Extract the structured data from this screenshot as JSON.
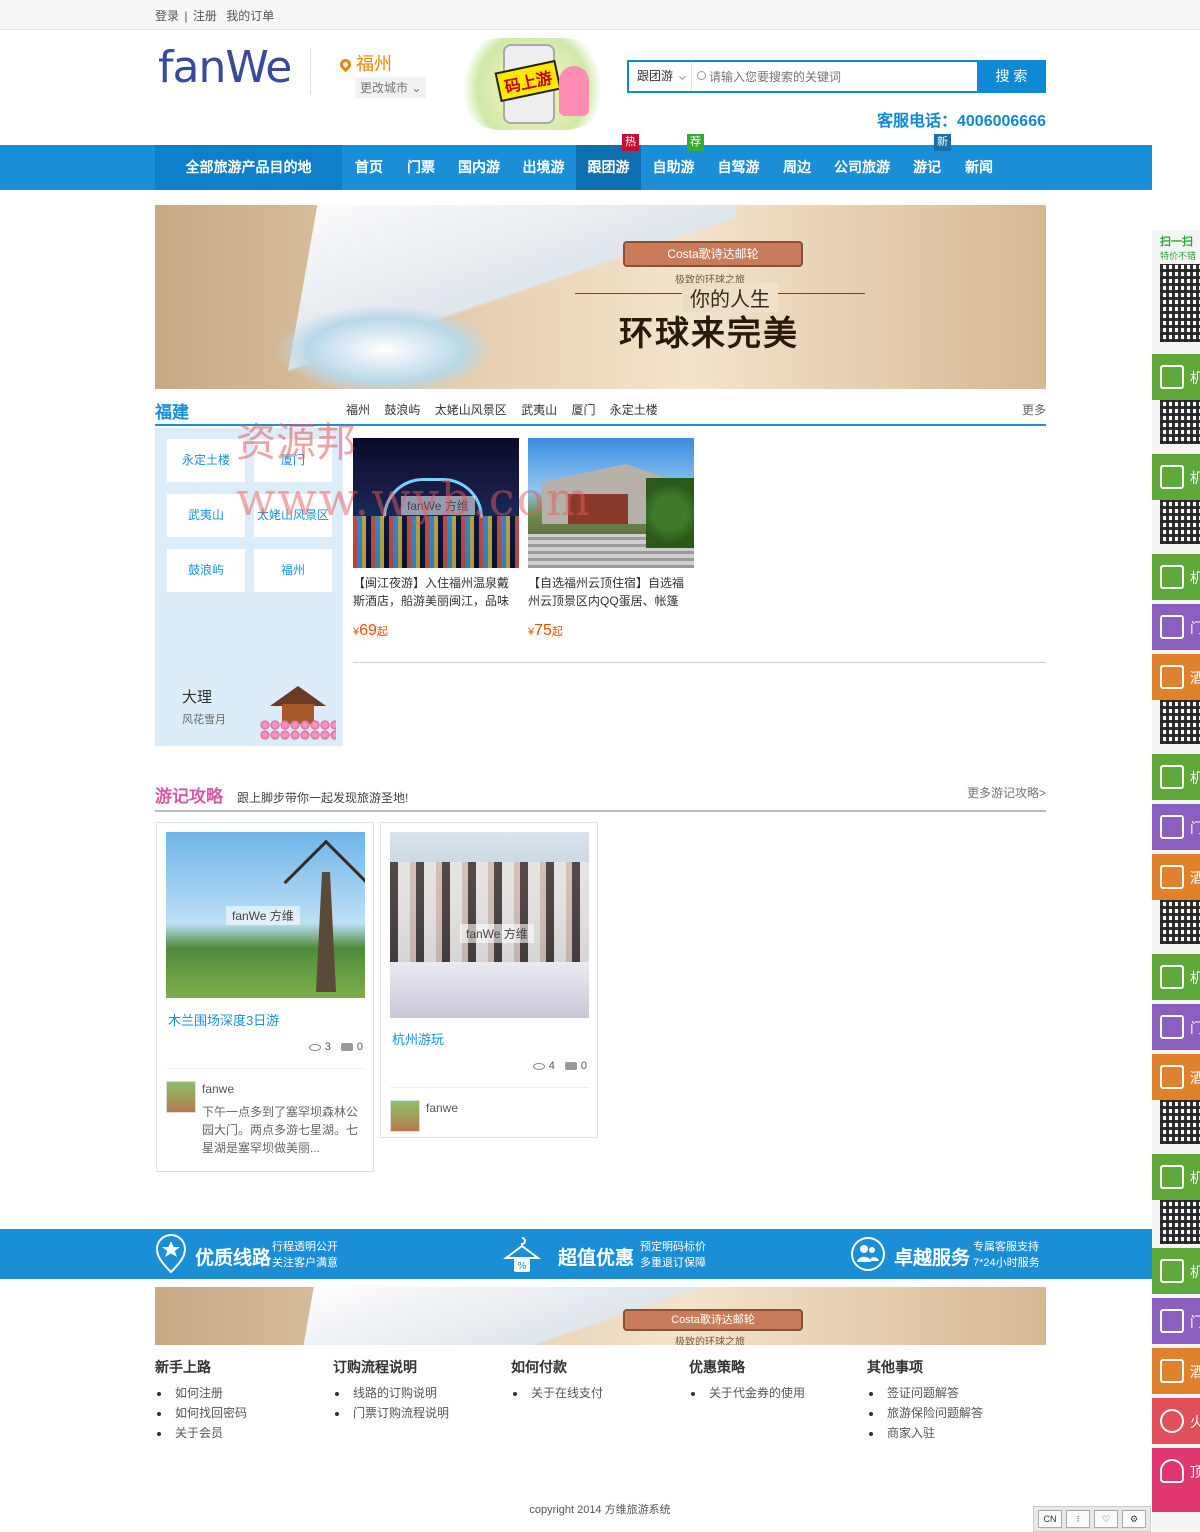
{
  "topbar": {
    "login": "登录",
    "sep": "|",
    "register": "注册",
    "orders": "我的订单"
  },
  "header": {
    "logo_main": "fanWe",
    "city": "福州",
    "change_city": "更改城市",
    "promo_text": "码上游",
    "search_scope": "跟团游",
    "search_placeholder": "请输入您要搜索的关键词",
    "search_button": "搜 索",
    "hotline": "客服电话：4006006666"
  },
  "nav": {
    "all_label": "全部旅游产品目的地",
    "items": [
      {
        "label": "首页",
        "badge": ""
      },
      {
        "label": "门票",
        "badge": ""
      },
      {
        "label": "国内游",
        "badge": ""
      },
      {
        "label": "出境游",
        "badge": ""
      },
      {
        "label": "跟团游",
        "badge": "热"
      },
      {
        "label": "自助游",
        "badge": "荐"
      },
      {
        "label": "自驾游",
        "badge": ""
      },
      {
        "label": "周边",
        "badge": ""
      },
      {
        "label": "公司旅游",
        "badge": ""
      },
      {
        "label": "游记",
        "badge": "新"
      },
      {
        "label": "新闻",
        "badge": ""
      }
    ],
    "badge_colors": {
      "热": "#c8102e",
      "荐": "#3aa635",
      "新": "#1a6fa8"
    }
  },
  "banner": {
    "brand": "Costa歌诗达邮轮",
    "tagline": "极致的环球之旅",
    "line1": "你的人生",
    "line2": "环球来完美"
  },
  "fujian": {
    "title": "福建",
    "tabs": [
      "福州",
      "鼓浪屿",
      "太姥山风景区",
      "武夷山",
      "厦门",
      "永定土楼"
    ],
    "more": "更多",
    "tags": [
      "永定土楼",
      "厦门",
      "武夷山",
      "太姥山风景区",
      "鼓浪屿",
      "福州"
    ],
    "promo_name": "大理",
    "promo_desc": "风花雪月",
    "products": [
      {
        "name": "【闽江夜游】入住福州温泉戴斯酒店，船游美丽闽江，品味夜...",
        "currency": "¥",
        "price": "69",
        "suffix": "起",
        "watermark": "fanWe 方维"
      },
      {
        "name": "【自选福州云顶住宿】自选福州云顶景区内QQ蛋居、帐篷房...",
        "currency": "¥",
        "price": "75",
        "suffix": "起",
        "watermark": ""
      }
    ]
  },
  "notes": {
    "title": "游记攻略",
    "subtitle": "跟上脚步带你一起发现旅游圣地!",
    "more": "更多游记攻略>",
    "cards": [
      {
        "title": "木兰围场深度3日游",
        "views": "3",
        "comments": "0",
        "user": "fanwe",
        "desc": "下午一点多到了塞罕坝森林公园大门。两点多游七星湖。七星湖是塞罕坝做美丽...",
        "watermark": "fanWe 方维"
      },
      {
        "title": "杭州游玩",
        "views": "4",
        "comments": "0",
        "user": "fanwe",
        "desc": "",
        "watermark": "fanWe 方维"
      }
    ]
  },
  "features": [
    {
      "big": "优质线路",
      "l1": "行程透明公开",
      "l2": "关注客户满意"
    },
    {
      "big": "超值优惠",
      "l1": "预定明码标价",
      "l2": "多重退订保障"
    },
    {
      "big": "卓越服务",
      "l1": "专属客服支持",
      "l2": "7*24小时服务"
    }
  ],
  "footer": {
    "cols": [
      {
        "title": "新手上路",
        "items": [
          "如何注册",
          "如何找回密码",
          "关于会员"
        ]
      },
      {
        "title": "订购流程说明",
        "items": [
          "线路的订购说明",
          "门票订购流程说明"
        ]
      },
      {
        "title": "如何付款",
        "items": [
          "关于在线支付"
        ]
      },
      {
        "title": "优惠策略",
        "items": [
          "关于代金券的使用"
        ]
      },
      {
        "title": "其他事项",
        "items": [
          "签证问题解答",
          "旅游保险问题解答",
          "商家入驻"
        ]
      }
    ],
    "copyright": "copyright 2014 方维旅游系统"
  },
  "side": {
    "scan": "扫一扫",
    "scan_sub": "特价不错",
    "tiles": [
      "机",
      "机",
      "机",
      "门",
      "酒",
      "机",
      "门",
      "酒",
      "机",
      "门",
      "酒",
      "机",
      "机",
      "门",
      "酒",
      "火",
      "顶"
    ],
    "tile_colors": {
      "机": "#5ea93a",
      "门": "#8b5fbf",
      "酒": "#e0812b",
      "火": "#e0505a",
      "顶": "#e0366f"
    }
  },
  "corner": {
    "cn": "CN",
    "b2": "⁝",
    "b3": "♡",
    "b4": "⚙"
  },
  "watermark": {
    "line1": "资源邦",
    "line2": "www.wyb.com"
  }
}
